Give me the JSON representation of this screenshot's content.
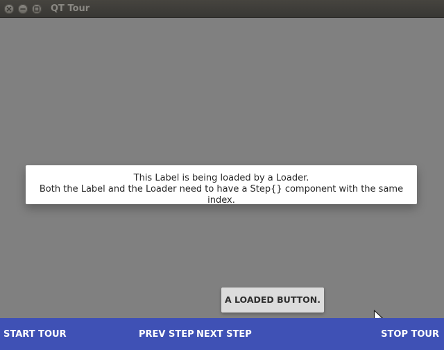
{
  "window": {
    "title": "QT Tour",
    "controls": [
      "close-icon",
      "minimize-icon",
      "maximize-icon"
    ]
  },
  "label": {
    "line1": "This Label is being loaded by a Loader.",
    "line2": "Both the Label and the Loader need to have a Step{} component with the same index."
  },
  "loaded_button": {
    "label": "A LOADED BUTTON."
  },
  "footer": {
    "start": "START TOUR",
    "prev": "PREV STEP",
    "next": "NEXT STEP",
    "stop": "STOP TOUR"
  },
  "colors": {
    "background": "#808080",
    "footer": "#3f51b5",
    "titlebar": "#3c3b37"
  }
}
